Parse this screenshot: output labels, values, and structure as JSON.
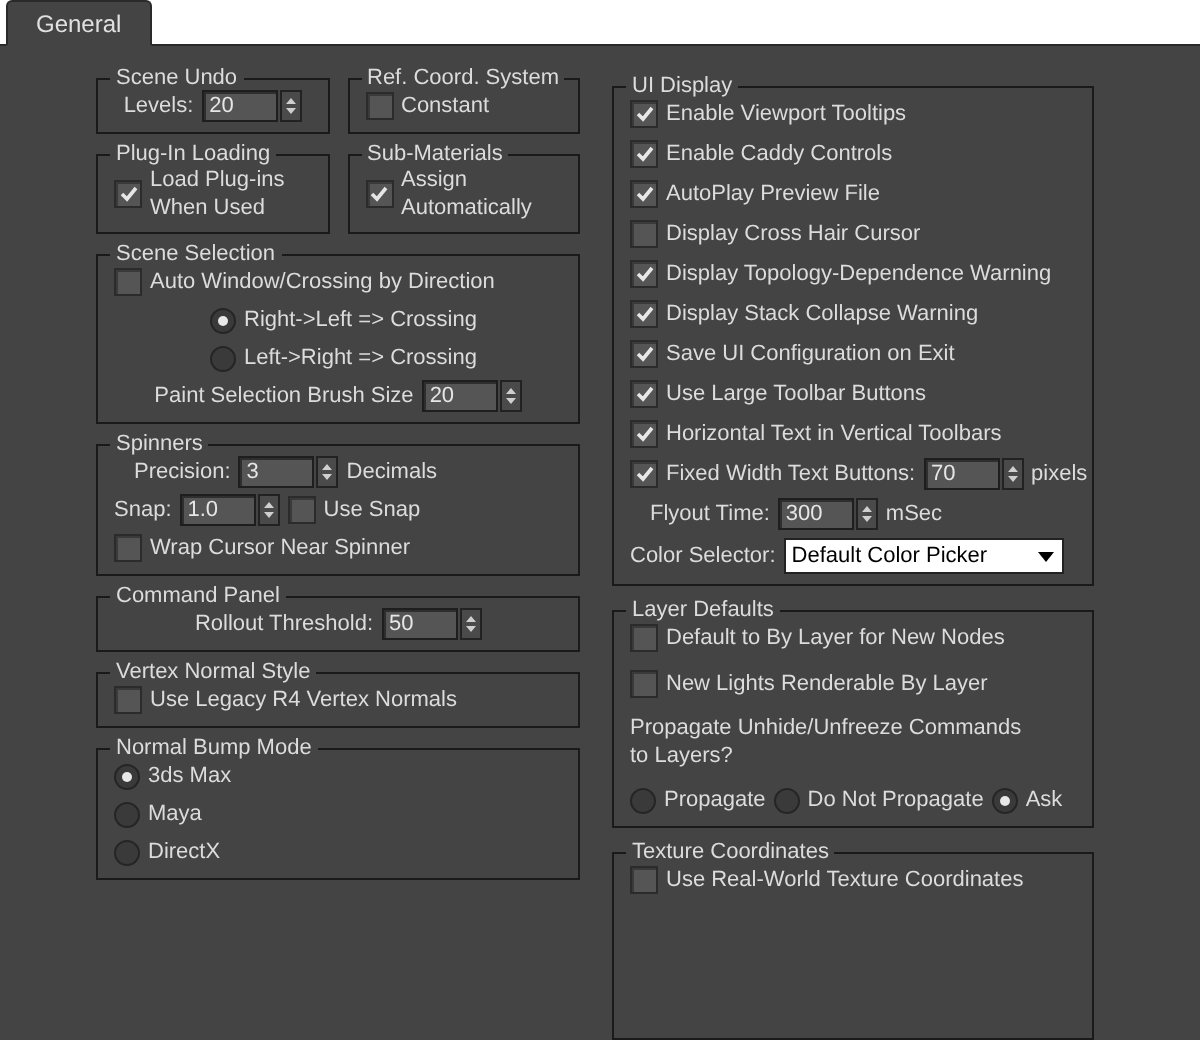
{
  "tab": {
    "label": "General",
    "selected": true
  },
  "left_column": [
    {
      "groups": [
        {
          "title": "Scene Undo",
          "items": [
            {
              "kind": "spinner",
              "label": "Levels:",
              "value": "20"
            }
          ]
        },
        {
          "title": "Ref. Coord. System",
          "items": [
            {
              "kind": "checkbox",
              "label": "Constant",
              "checked": false
            }
          ]
        }
      ]
    },
    {
      "groups": [
        {
          "title": "Plug-In Loading",
          "items": [
            {
              "kind": "checkbox",
              "label": "Load Plug-ins\nWhen Used",
              "checked": true
            }
          ]
        },
        {
          "title": "Sub-Materials",
          "items": [
            {
              "kind": "checkbox",
              "label": "Assign\nAutomatically",
              "checked": true
            }
          ]
        }
      ]
    },
    {
      "groups": [
        {
          "title": "Scene Selection",
          "items": [
            {
              "kind": "checkbox",
              "label": "Auto Window/Crossing by Direction",
              "checked": false
            },
            {
              "kind": "radio",
              "label": "Right->Left => Crossing",
              "selected": true
            },
            {
              "kind": "radio",
              "label": "Left->Right => Crossing",
              "selected": false
            },
            {
              "kind": "spinner",
              "label": "Paint Selection Brush Size",
              "value": "20"
            }
          ]
        }
      ]
    },
    {
      "groups": [
        {
          "title": "Spinners",
          "items": [
            {
              "kind": "spinner",
              "label": "Precision:",
              "value": "3",
              "suffix": "Decimals"
            },
            {
              "kind": "row",
              "items": [
                {
                  "kind": "spinner",
                  "label": "Snap:",
                  "value": "1.0"
                },
                {
                  "kind": "checkbox",
                  "label": "Use Snap",
                  "checked": false
                }
              ]
            },
            {
              "kind": "checkbox",
              "label": "Wrap Cursor Near Spinner",
              "checked": false
            }
          ]
        }
      ]
    },
    {
      "groups": [
        {
          "title": "Command Panel",
          "items": [
            {
              "kind": "spinner",
              "label": "Rollout Threshold:",
              "value": "50"
            }
          ]
        }
      ]
    },
    {
      "groups": [
        {
          "title": "Vertex Normal Style",
          "items": [
            {
              "kind": "checkbox",
              "label": "Use Legacy R4 Vertex Normals",
              "checked": false
            }
          ]
        }
      ]
    },
    {
      "groups": [
        {
          "title": "Normal Bump Mode",
          "items": [
            {
              "kind": "radio",
              "label": "3ds Max",
              "selected": true
            },
            {
              "kind": "radio",
              "label": "Maya",
              "selected": false
            },
            {
              "kind": "radio",
              "label": "DirectX",
              "selected": false
            }
          ]
        }
      ]
    }
  ],
  "right_column": [
    {
      "title": "UI Display",
      "items": [
        {
          "kind": "checkbox",
          "label": "Enable Viewport Tooltips",
          "checked": true
        },
        {
          "kind": "checkbox",
          "label": "Enable Caddy Controls",
          "checked": true
        },
        {
          "kind": "checkbox",
          "label": "AutoPlay Preview File",
          "checked": true
        },
        {
          "kind": "checkbox",
          "label": "Display Cross Hair Cursor",
          "checked": false
        },
        {
          "kind": "checkbox",
          "label": "Display Topology-Dependence Warning",
          "checked": true
        },
        {
          "kind": "checkbox",
          "label": "Display Stack Collapse Warning",
          "checked": true
        },
        {
          "kind": "checkbox",
          "label": "Save UI Configuration on Exit",
          "checked": true
        },
        {
          "kind": "checkbox",
          "label": "Use Large Toolbar Buttons",
          "checked": true
        },
        {
          "kind": "checkbox",
          "label": "Horizontal Text in Vertical Toolbars",
          "checked": true
        },
        {
          "kind": "row",
          "items": [
            {
              "kind": "checkbox",
              "label": "Fixed Width Text Buttons:",
              "checked": true
            },
            {
              "kind": "spinner",
              "value": "70",
              "suffix": "pixels"
            }
          ]
        },
        {
          "kind": "spinner",
          "label": "Flyout Time:",
          "value": "300",
          "suffix": "mSec"
        },
        {
          "kind": "dropdown",
          "label": "Color Selector:",
          "value": "Default Color Picker"
        }
      ]
    },
    {
      "title": "Layer Defaults",
      "items": [
        {
          "kind": "checkbox",
          "label": "Default to By Layer for New Nodes",
          "checked": false
        },
        {
          "kind": "checkbox",
          "label": "New Lights Renderable By Layer",
          "checked": false
        },
        {
          "kind": "text",
          "text": "Propagate Unhide/Unfreeze Commands\nto Layers?"
        },
        {
          "kind": "row",
          "items": [
            {
              "kind": "radio",
              "label": "Propagate",
              "selected": false
            },
            {
              "kind": "radio",
              "label": "Do Not Propagate",
              "selected": false
            },
            {
              "kind": "radio",
              "label": "Ask",
              "selected": true
            }
          ]
        }
      ]
    },
    {
      "title": "Texture Coordinates",
      "items": [
        {
          "kind": "checkbox",
          "label": "Use Real-World Texture Coordinates",
          "checked": false
        }
      ]
    }
  ]
}
